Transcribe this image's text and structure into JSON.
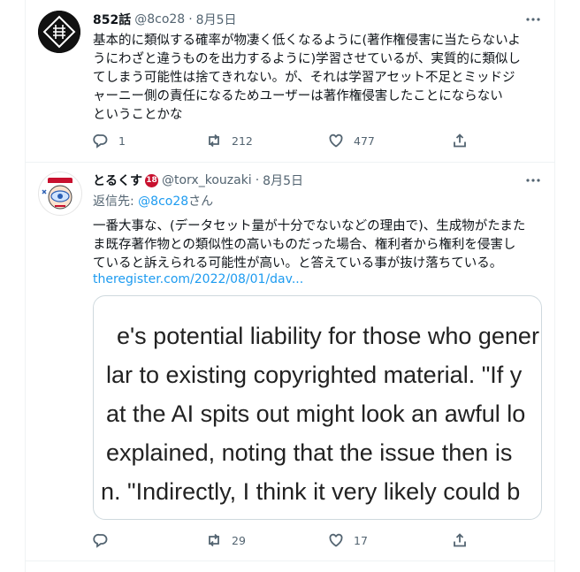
{
  "tweet1": {
    "name": "852話",
    "handle": "@8co28",
    "date": "8月5日",
    "text_lines": [
      "基本的に類似する確率が物凄く低くなるように(著作権侵害に当たらないよ",
      "うにわざと違うものを出力するように)学習させているが、実質的に類似し",
      "てしまう可能性は捨てきれない。が、それは学習アセット不足とミッドジ",
      "ャーニー側の責任になるためユーザーは著作権侵害したことにならない",
      "ということかな"
    ],
    "reply_count": "1",
    "retweet_count": "212",
    "like_count": "477"
  },
  "tweet2": {
    "name": "とるくす",
    "badge": "18",
    "handle": "@torx_kouzaki",
    "date": "8月5日",
    "reply_prefix": "返信先: ",
    "reply_mention": "@8co28",
    "reply_suffix": "さん",
    "text_lines": [
      "一番大事な、(データセット量が十分でないなどの理由で)、生成物がたまた",
      "ま既存著作物との類似性の高いものだった場合、権利者から権利を侵害し",
      "ていると訴えられる可能性が高い。と答えている事が抜け落ちている。"
    ],
    "link": "theregister.com/2022/08/01/dav...",
    "card_lines": [
      "e's potential liability for those who gener",
      "lar to existing copyrighted material. \"If y",
      "at the AI spits out might look an awful lo",
      "explained, noting that the issue then is",
      "n. \"Indirectly, I think it very likely could b"
    ],
    "retweet_count": "29",
    "like_count": "17"
  },
  "colors": {
    "accent": "#1d9bf0",
    "muted": "#536471",
    "text": "#0f1419",
    "border": "#eff3f4"
  },
  "icons": [
    "more-icon",
    "reply-icon",
    "retweet-icon",
    "like-icon",
    "share-icon"
  ]
}
